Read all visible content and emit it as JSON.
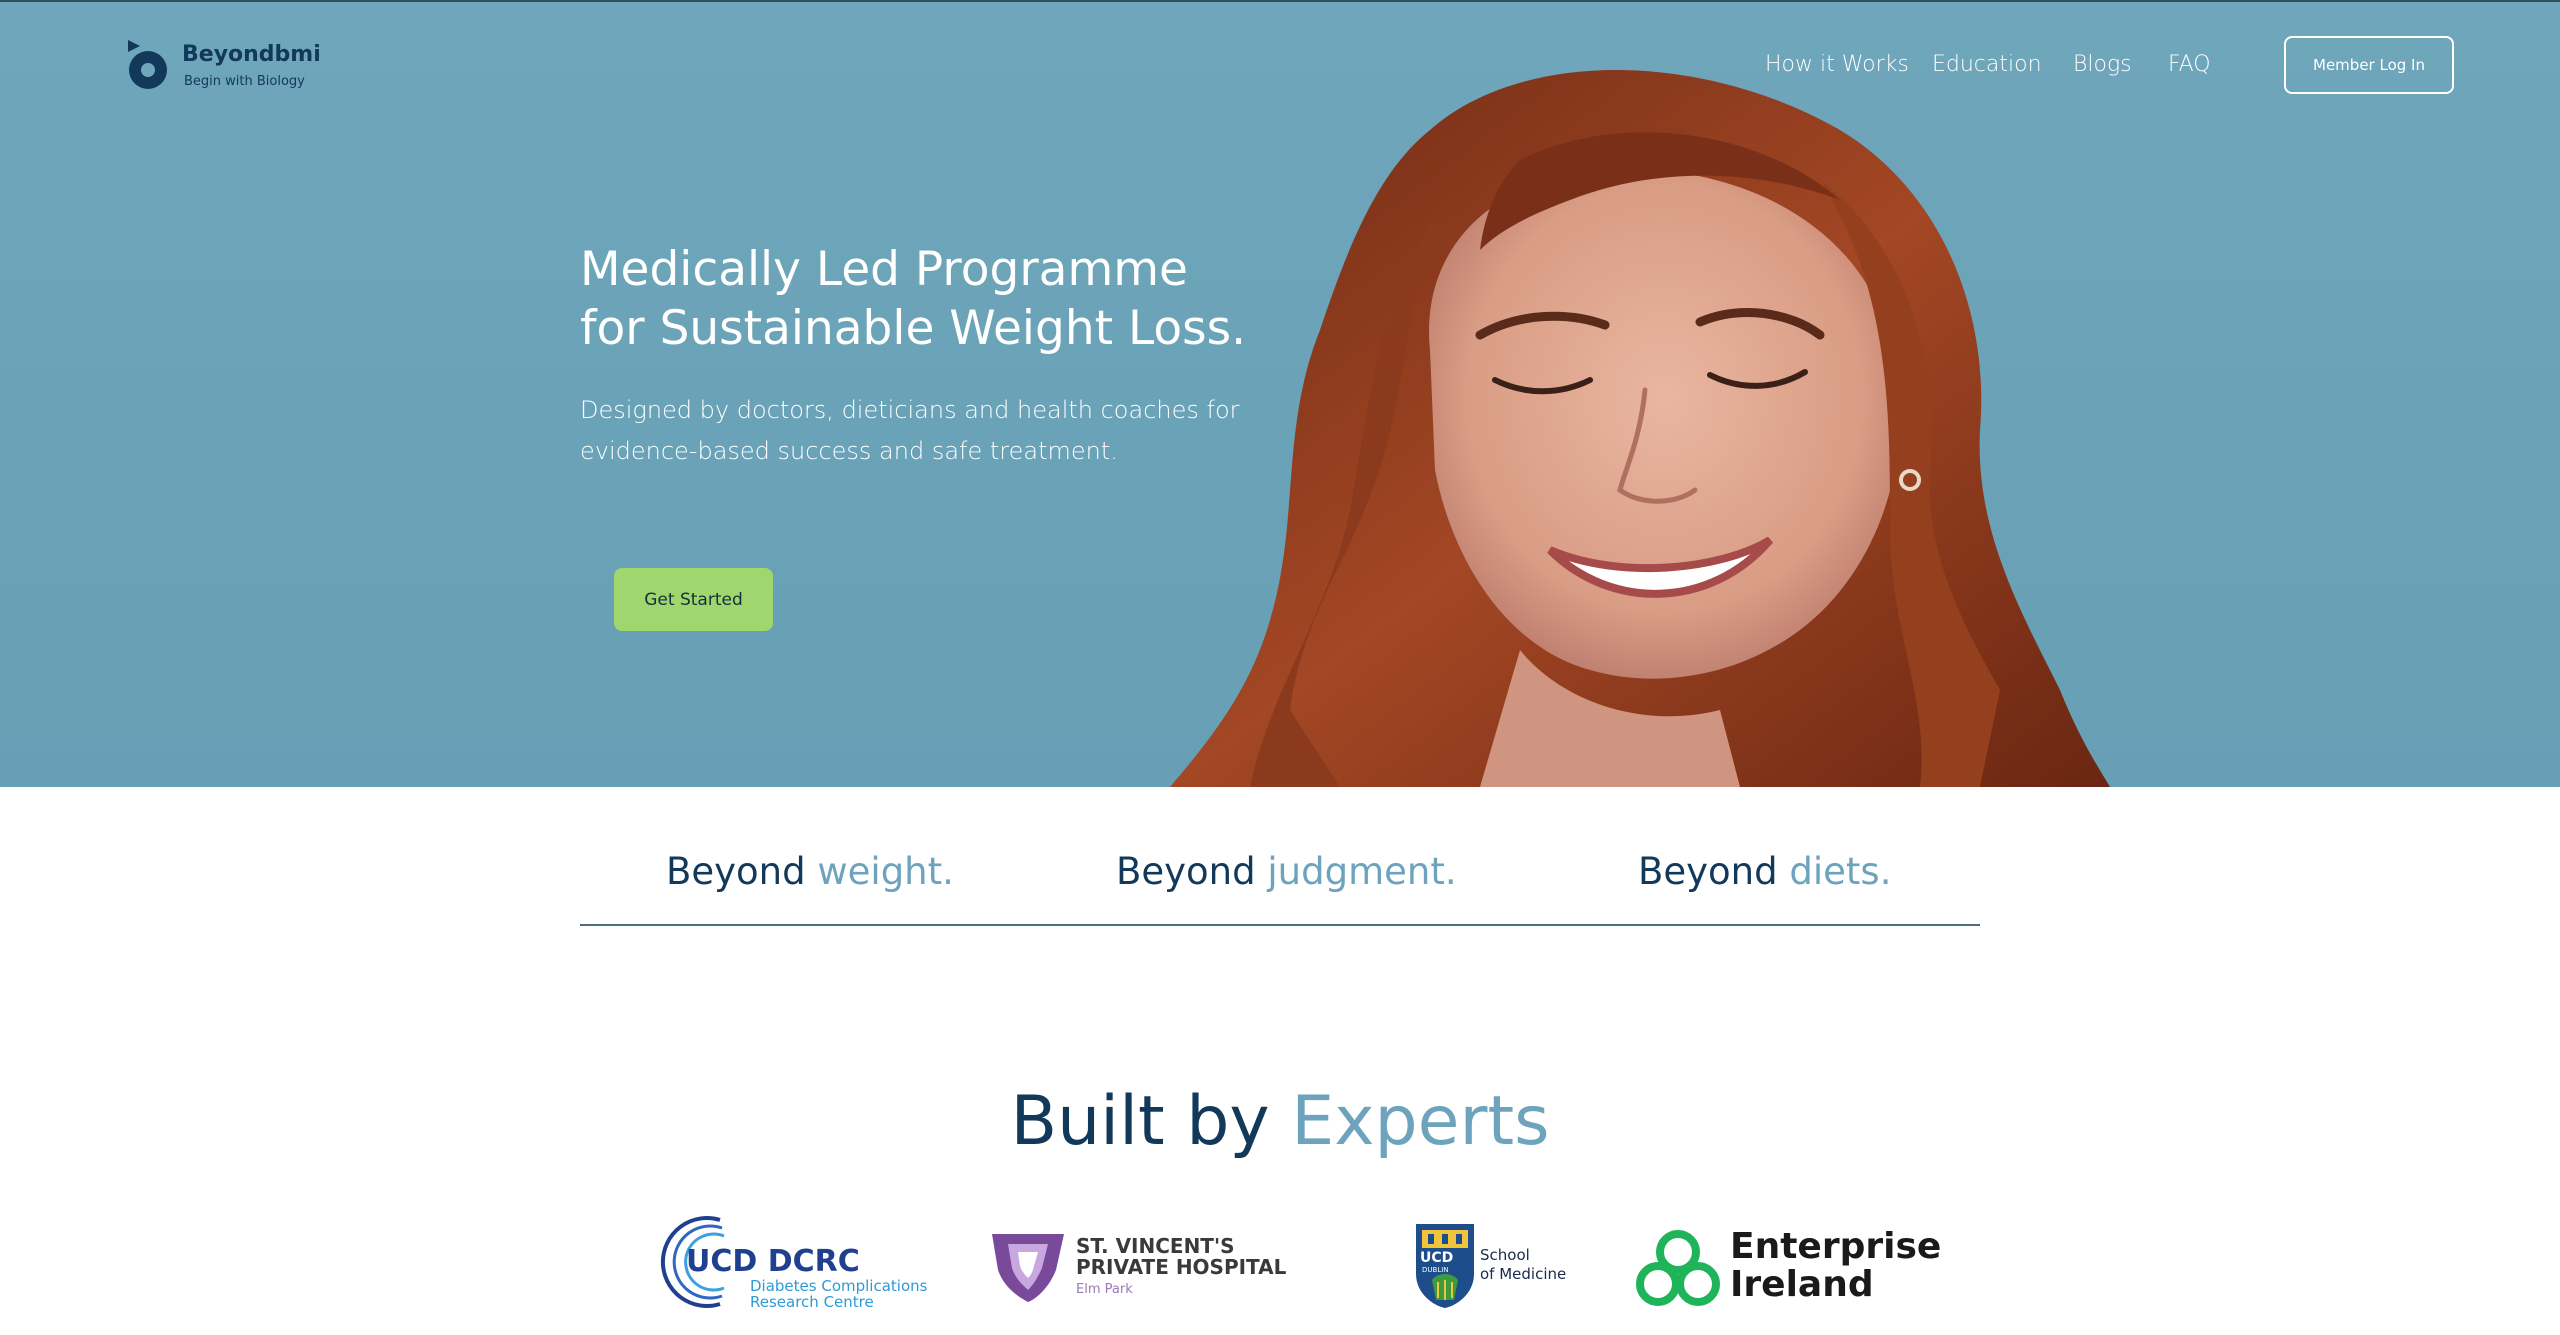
{
  "brand": {
    "name": "Beyondbmi",
    "tagline": "Begin with Biology"
  },
  "nav": {
    "items": [
      "How it Works",
      "Education",
      "Blogs",
      "FAQ"
    ],
    "login_label": "Member Log In"
  },
  "hero": {
    "title_line1": "Medically Led Programme",
    "title_line2": "for Sustainable Weight Loss.",
    "subtitle_line1": "Designed by doctors, dieticians and health coaches for",
    "subtitle_line2": "evidence-based success and safe treatment.",
    "cta_label": "Get Started"
  },
  "taglines": [
    {
      "lead": "Beyond",
      "accent": "weight."
    },
    {
      "lead": "Beyond",
      "accent": "judgment."
    },
    {
      "lead": "Beyond",
      "accent": "diets."
    }
  ],
  "experts": {
    "title_lead": "Built by",
    "title_accent": "Experts"
  },
  "partners": {
    "ucd_dcrc": {
      "name": "UCD DCRC",
      "line1": "Diabetes Complications",
      "line2": "Research Centre"
    },
    "st_vincents": {
      "line1": "ST. VINCENT'S",
      "line2": "PRIVATE HOSPITAL",
      "line3": "Elm Park"
    },
    "ucd_medicine": {
      "badge": "UCD",
      "badge_sub": "DUBLIN",
      "line1": "School",
      "line2": "of Medicine"
    },
    "enterprise_ireland": {
      "line1": "Enterprise",
      "line2": "Ireland"
    }
  },
  "colors": {
    "hero_bg": "#6aa2b7",
    "navy": "#12395a",
    "accent_blue": "#6ea3bd",
    "cta_green": "#9fd66e"
  }
}
